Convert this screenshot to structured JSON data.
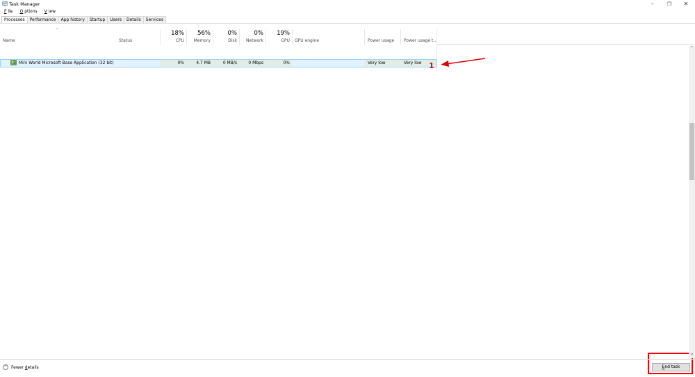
{
  "window": {
    "title": "Task Manager",
    "minimize_glyph": "–",
    "maximize_glyph": "❐",
    "close_glyph": "✕"
  },
  "menu": {
    "file": {
      "accel": "F",
      "rest": "ile"
    },
    "options": {
      "accel": "O",
      "rest": "ptions"
    },
    "view": {
      "accel": "V",
      "rest": "iew"
    }
  },
  "tabs": [
    "Processes",
    "Performance",
    "App history",
    "Startup",
    "Users",
    "Details",
    "Services"
  ],
  "header": {
    "sort_glyph": "^",
    "name": "Name",
    "status": "Status",
    "cpu": {
      "pct": "18%",
      "label": "CPU"
    },
    "memory": {
      "pct": "56%",
      "label": "Memory"
    },
    "disk": {
      "pct": "0%",
      "label": "Disk"
    },
    "network": {
      "pct": "0%",
      "label": "Network"
    },
    "gpu": {
      "pct": "19%",
      "label": "GPU"
    },
    "gpu_engine": "GPU engine",
    "power_usage": "Power usage",
    "power_usage_trend": "Power usage t..."
  },
  "process": {
    "name": "Mini World Microsoft Base Application (32 bit)",
    "icon": "app-icon",
    "status": "",
    "cpu": "0%",
    "memory": "4.7 MB",
    "disk": "0 MB/s",
    "network": "0 Mbps",
    "gpu": "0%",
    "gpu_engine": "",
    "power_usage": "Very low",
    "power_usage_trend": "Very low"
  },
  "annotation": {
    "number": "1",
    "color": "#e00000"
  },
  "scrollbar": {
    "up_glyph": "^",
    "down_glyph": "v"
  },
  "footer": {
    "fewer_icon_glyph": "^",
    "fewer_details": {
      "pre": "Fewer ",
      "accel": "d",
      "post": "etails"
    },
    "end_task": {
      "accel": "E",
      "rest": "nd task"
    }
  }
}
